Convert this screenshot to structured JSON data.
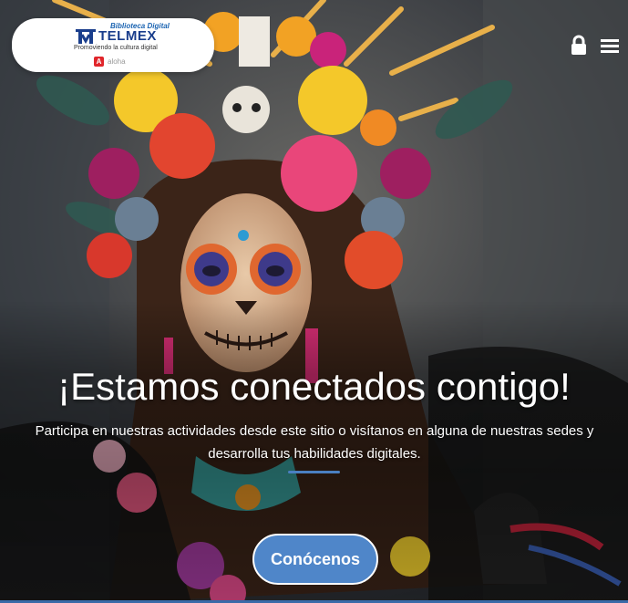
{
  "header": {
    "logo": {
      "top_line": "Biblioteca Digital",
      "brand": "TELMEX",
      "tagline": "Promoviendo la cultura digital",
      "footer_badge": "A",
      "footer_text": "aloha"
    },
    "icons": {
      "lock": "lock-icon",
      "menu": "hamburger-menu-icon"
    }
  },
  "hero": {
    "image": "day-of-the-dead-catrina-portrait",
    "title": "¡Estamos conectados contigo!",
    "description": "Participa en nuestras actividades desde este sitio o visítanos en alguna de nuestras sedes y desarrolla tus habilidades digitales.",
    "cta_label": "Conócenos"
  },
  "colors": {
    "accent": "#4f86c9",
    "brand_blue": "#1a3e8c",
    "divider": "#4a7fc1"
  }
}
